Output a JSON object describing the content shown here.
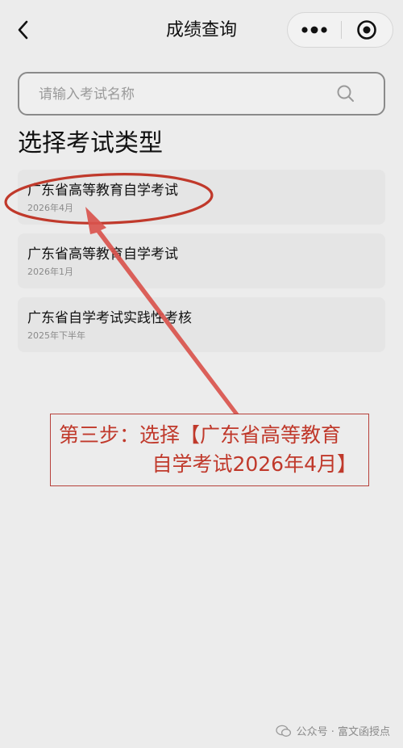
{
  "navbar": {
    "title": "成绩查询",
    "back_icon": "chevron-left-icon",
    "more_icon": "more-dots-icon",
    "close_icon": "target-close-icon"
  },
  "search": {
    "placeholder": "请输入考试名称",
    "value": "",
    "icon": "search-icon"
  },
  "section_title": "选择考试类型",
  "exams": [
    {
      "name": "广东省高等教育自学考试",
      "date": "2026年4月"
    },
    {
      "name": "广东省高等教育自学考试",
      "date": "2026年1月"
    },
    {
      "name": "广东省自学考试实践性考核",
      "date": "2025年下半年"
    }
  ],
  "annotation": {
    "line1": "第三步：选择【广东省高等教育",
    "line2": "自学考试2026年4月】",
    "color": "#c0392b"
  },
  "watermark": {
    "text": "公众号 · 富文函授点",
    "icon": "wechat-icon"
  }
}
